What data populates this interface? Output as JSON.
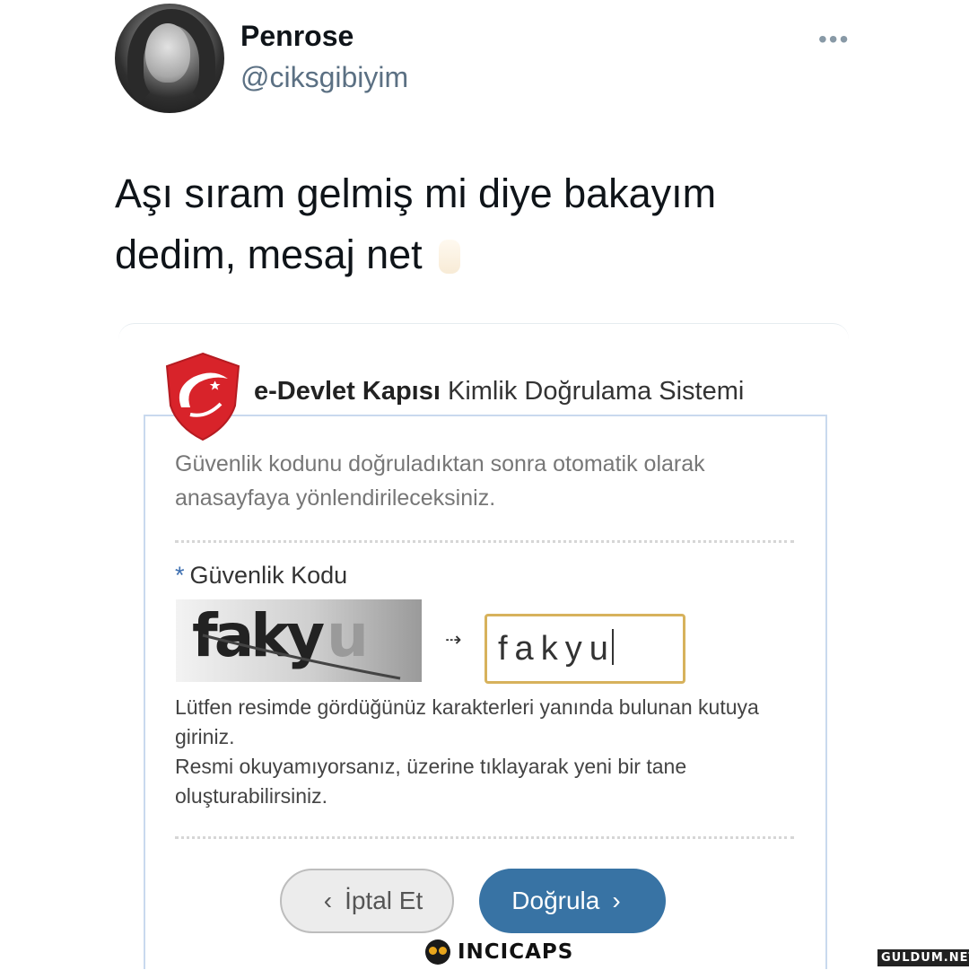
{
  "tweet": {
    "display_name": "Penrose",
    "handle": "@ciksgibiyim",
    "more_icon": "more-dots-icon",
    "text_line1": "Aşı sıram gelmiş mi diye bakayım",
    "text_line2": "dedim, mesaj net",
    "emoji": "ok-hand-emoji"
  },
  "edevlet": {
    "title_bold": "e-Devlet Kapısı",
    "title_rest": "Kimlik Doğrulama Sistemi",
    "info_text": "Güvenlik kodunu doğruladıktan sonra otomatik olarak anasayfaya yönlendirileceksiniz.",
    "code_label_star": "*",
    "code_label": "Güvenlik Kodu",
    "captcha_main": "faky",
    "captcha_faded": "u",
    "arrow": "⇢",
    "code_value": "fakyu",
    "help_line1": "Lütfen resimde gördüğünüz karakterleri yanında bulunan kutuya giriniz.",
    "help_line2": "Resmi okuyamıyorsanız, üzerine tıklayarak yeni bir tane oluşturabilirsiniz.",
    "cancel_label": "İptal Et",
    "verify_label": "Doğrula",
    "accent_color": "#3873a4",
    "shield_color": "#d8232a"
  },
  "watermarks": {
    "incicaps": "INCICAPS",
    "guldum": "GULDUM.NET"
  }
}
